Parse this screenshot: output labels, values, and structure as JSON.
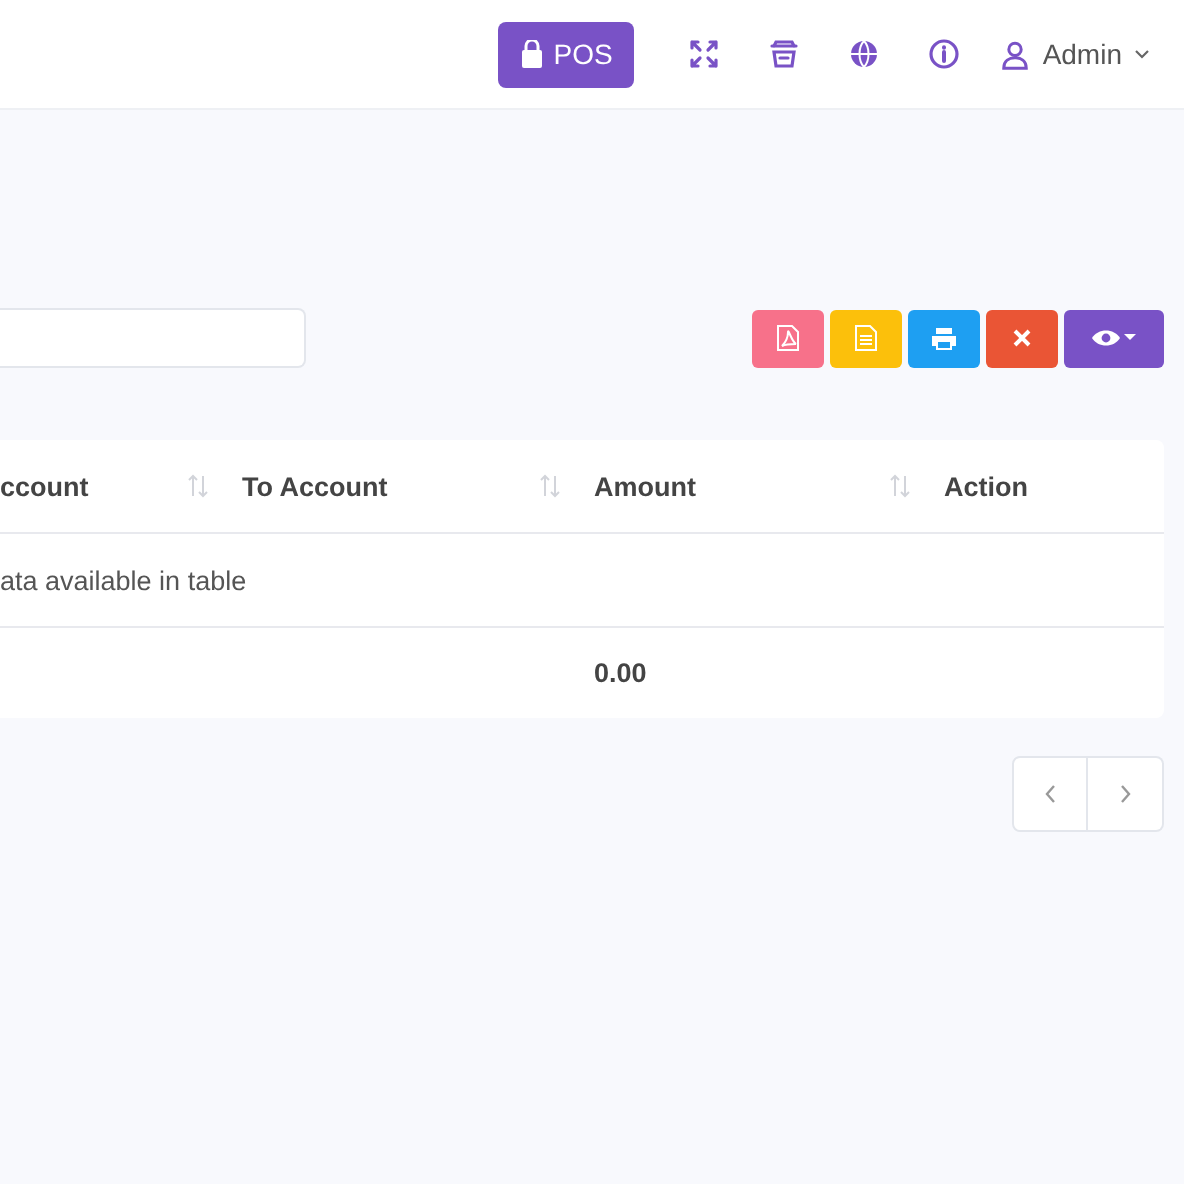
{
  "header": {
    "pos_button": "POS",
    "user": "Admin"
  },
  "table": {
    "columns": [
      {
        "label": "ccount",
        "sortable": true
      },
      {
        "label": "To Account",
        "sortable": true
      },
      {
        "label": "Amount",
        "sortable": true
      },
      {
        "label": "Action",
        "sortable": false
      }
    ],
    "empty_message": "ata available in table",
    "footer": {
      "amount": "0.00"
    }
  }
}
